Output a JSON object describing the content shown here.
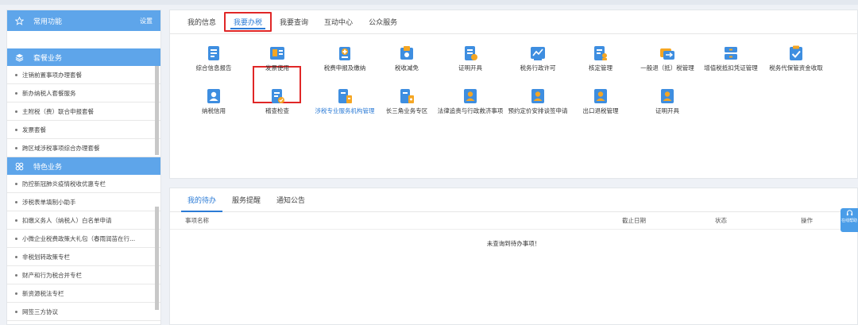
{
  "sidebar": {
    "header": {
      "title": "常用功能",
      "setting": "设置"
    },
    "sections": [
      {
        "title": "套餐业务",
        "items": [
          "注销前置事项办理套餐",
          "新办纳税人套餐服务",
          "主附税（费）联合申报套餐",
          "发票套餐",
          "跨区域涉税事项综合办理套餐"
        ]
      },
      {
        "title": "特色业务",
        "items": [
          "防控新冠肺炎疫情税收优惠专栏",
          "涉税表单填制小助手",
          "扣缴义务人（纳税人）白名单申请",
          "小微企业税费政策大礼包（春雨润苗在行...",
          "非税划转政策专栏",
          "财产和行为税合并专栏",
          "新资源税法专栏",
          "网签三方协议"
        ]
      }
    ]
  },
  "main": {
    "tabs": [
      "我的信息",
      "我要办税",
      "我要查询",
      "互动中心",
      "公众服务"
    ],
    "active_tab": "我要办税",
    "services": [
      "综合信息报告",
      "发票使用",
      "税费申报及缴纳",
      "税收减免",
      "证明开具",
      "税务行政许可",
      "核定管理",
      "一般退（抵）税管理",
      "增值税抵扣凭证管理",
      "税务代保管资金收取",
      "纳税信用",
      "稽查检查",
      "涉税专业服务机构管理",
      "长三角业务专区",
      "法律追责与行政救济事项",
      "预约定价安排谈签申请",
      "出口退税管理",
      "证明开具"
    ]
  },
  "todo": {
    "tabs": [
      "我的待办",
      "服务提醒",
      "通知公告"
    ],
    "columns": [
      "事项名称",
      "截止日期",
      "状态",
      "操作"
    ],
    "empty_text": "未查询到待办事项！"
  },
  "float_help": "在线帮助",
  "colors": {
    "accent": "#2b7bd6",
    "sidebar_header": "#5ea5ea",
    "highlight_box": "#e02727",
    "icon_primary": "#3e8ee0",
    "icon_secondary": "#f5a623"
  }
}
